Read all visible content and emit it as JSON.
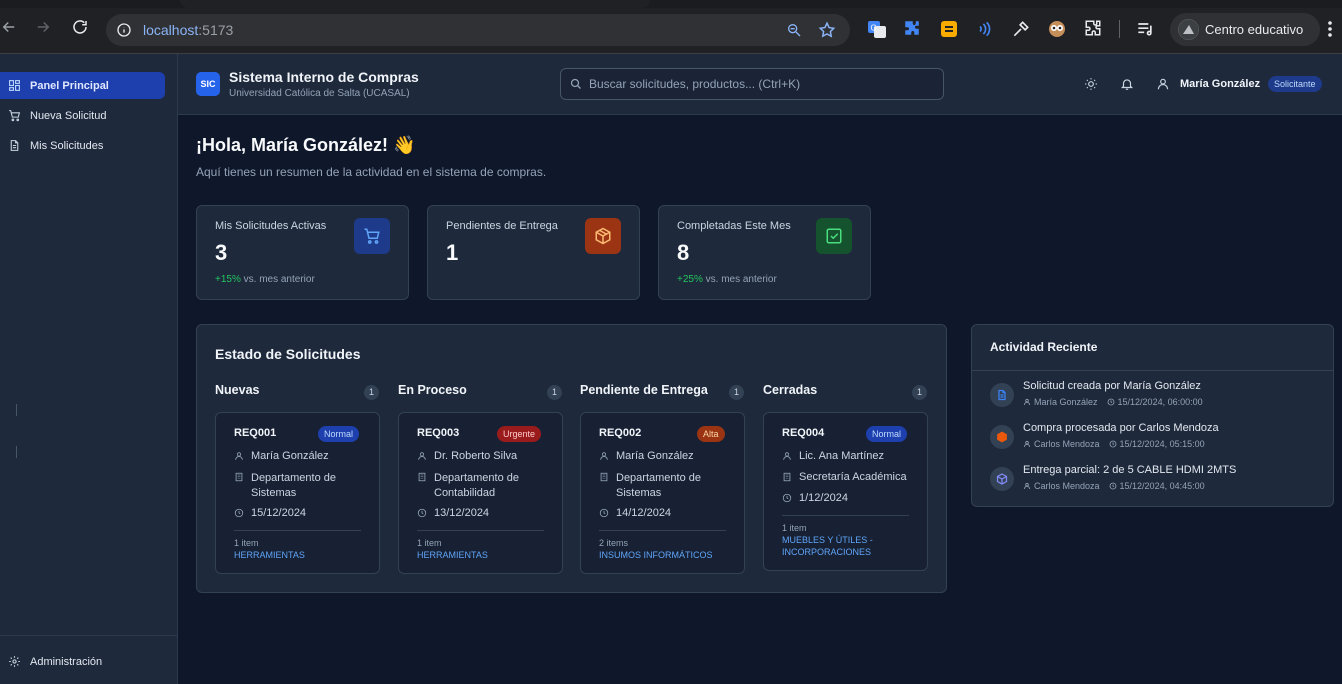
{
  "browser": {
    "url_host": "localhost",
    "url_port": ":5173",
    "profile_name": "Centro educativo"
  },
  "sidebar": {
    "items": [
      {
        "label": "Panel Principal",
        "icon": "dashboard-icon"
      },
      {
        "label": "Nueva Solicitud",
        "icon": "cart-icon"
      },
      {
        "label": "Mis Solicitudes",
        "icon": "document-icon"
      }
    ],
    "footer": {
      "label": "Administración",
      "icon": "gear-icon"
    }
  },
  "header": {
    "logo": "SIC",
    "title": "Sistema Interno de Compras",
    "subtitle": "Universidad Católica de Salta (UCASAL)",
    "search_placeholder": "Buscar solicitudes, productos... (Ctrl+K)",
    "user_name": "María González",
    "user_role": "Solicitante"
  },
  "greeting": {
    "title": "¡Hola, María González! 👋",
    "subtitle": "Aquí tienes un resumen de la actividad en el sistema de compras."
  },
  "stats": [
    {
      "label": "Mis Solicitudes Activas",
      "value": "3",
      "change": "+15%",
      "change_suffix": " vs. mes anterior",
      "icon": "cart-icon",
      "color": "#1e3a8a"
    },
    {
      "label": "Pendientes de Entrega",
      "value": "1",
      "icon": "package-icon",
      "color": "#9a3412"
    },
    {
      "label": "Completadas Este Mes",
      "value": "8",
      "change": "+25%",
      "change_suffix": " vs. mes anterior",
      "icon": "check-square-icon",
      "color": "#14532d"
    }
  ],
  "board": {
    "title": "Estado de Solicitudes",
    "columns": [
      {
        "title": "Nuevas",
        "count": "1",
        "card": {
          "id": "REQ001",
          "priority": "Normal",
          "requester": "María González",
          "department": "Departamento de Sistemas",
          "date": "15/12/2024",
          "items": "1 item",
          "category": "HERRAMIENTAS"
        }
      },
      {
        "title": "En Proceso",
        "count": "1",
        "card": {
          "id": "REQ003",
          "priority": "Urgente",
          "requester": "Dr. Roberto Silva",
          "department": "Departamento de Contabilidad",
          "date": "13/12/2024",
          "items": "1 item",
          "category": "HERRAMIENTAS"
        }
      },
      {
        "title": "Pendiente de Entrega",
        "count": "1",
        "card": {
          "id": "REQ002",
          "priority": "Alta",
          "requester": "María González",
          "department": "Departamento de Sistemas",
          "date": "14/12/2024",
          "items": "2 items",
          "category": "INSUMOS INFORMÁTICOS"
        }
      },
      {
        "title": "Cerradas",
        "count": "1",
        "card": {
          "id": "REQ004",
          "priority": "Normal",
          "requester": "Lic. Ana Martínez",
          "department": "Secretaría Académica",
          "date": "1/12/2024",
          "items": "1 item",
          "category": "MUEBLES Y ÚTILES - INCORPORACIONES"
        }
      }
    ],
    "priority_colors": {
      "Normal": "#1e40af",
      "Urgente": "#991b1b",
      "Alta": "#9a3412"
    }
  },
  "activity": {
    "title": "Actividad Reciente",
    "items": [
      {
        "text": "Solicitud creada por María González",
        "user": "María González",
        "time": "15/12/2024, 06:00:00",
        "icon": "document-icon",
        "color": "#3b82f6"
      },
      {
        "text": "Compra procesada por Carlos Mendoza",
        "user": "Carlos Mendoza",
        "time": "15/12/2024, 05:15:00",
        "icon": "package-icon",
        "color": "#ea580c"
      },
      {
        "text": "Entrega parcial: 2 de 5 CABLE HDMI 2MTS",
        "user": "Carlos Mendoza",
        "time": "15/12/2024, 04:45:00",
        "icon": "package-icon",
        "color": "#818cf8"
      }
    ]
  }
}
